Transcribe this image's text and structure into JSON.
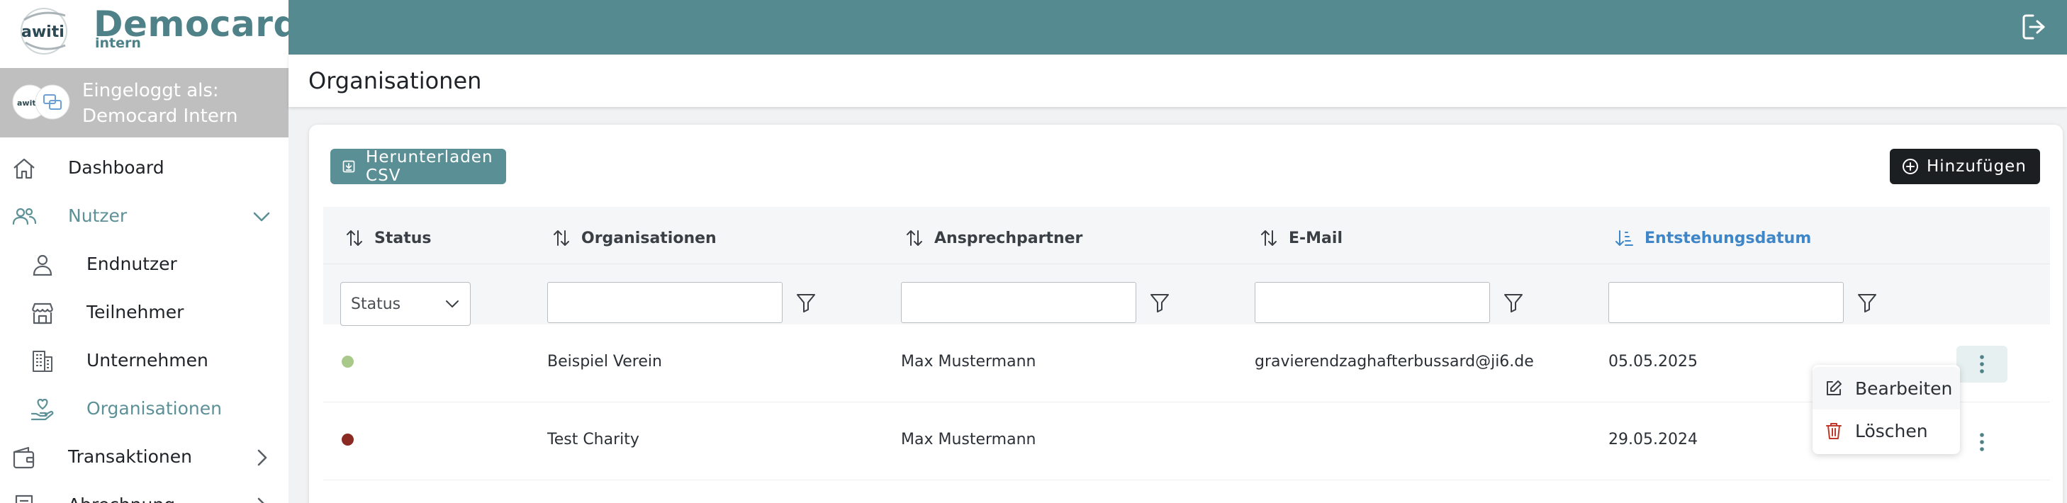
{
  "brand": {
    "logo_text": "awiti",
    "title": "Democard",
    "subtitle": "intern"
  },
  "header": {
    "logout_icon": "logout-icon",
    "page_title": "Organisationen"
  },
  "user": {
    "logged_in_label": "Eingeloggt als:",
    "name": "Democard Intern"
  },
  "sidebar": {
    "items": [
      {
        "label": "Dashboard",
        "icon": "home-icon"
      },
      {
        "label": "Nutzer",
        "icon": "users-icon",
        "expanded": true
      },
      {
        "label": "Endnutzer",
        "icon": "user-icon"
      },
      {
        "label": "Teilnehmer",
        "icon": "store-icon"
      },
      {
        "label": "Unternehmen",
        "icon": "building-icon"
      },
      {
        "label": "Organisationen",
        "icon": "heart-hand-icon",
        "active": true
      },
      {
        "label": "Transaktionen",
        "icon": "wallet-icon"
      },
      {
        "label": "Abrechnung",
        "icon": "invoice-icon"
      }
    ]
  },
  "toolbar": {
    "download_label": "Herunterladen CSV",
    "add_label": "Hinzufügen"
  },
  "table": {
    "columns": [
      "Status",
      "Organisationen",
      "Ansprechpartner",
      "E-Mail",
      "Entstehungsdatum"
    ],
    "status_filter_value": "Status",
    "rows": [
      {
        "status_color": "#a9c98a",
        "organisation": "Beispiel Verein",
        "contact": "Max Mustermann",
        "email": "gravierendzaghafterbussard@ji6.de",
        "date": "05.05.2025"
      },
      {
        "status_color": "#8b2a22",
        "organisation": "Test Charity",
        "contact": "Max Mustermann",
        "email": "",
        "date": "29.05.2024"
      }
    ]
  },
  "row_menu": {
    "edit_label": "Bearbeiten",
    "delete_label": "Löschen"
  },
  "colors": {
    "accent": "#558a90",
    "active_sort": "#3f86c8",
    "delete": "#c0392b"
  }
}
